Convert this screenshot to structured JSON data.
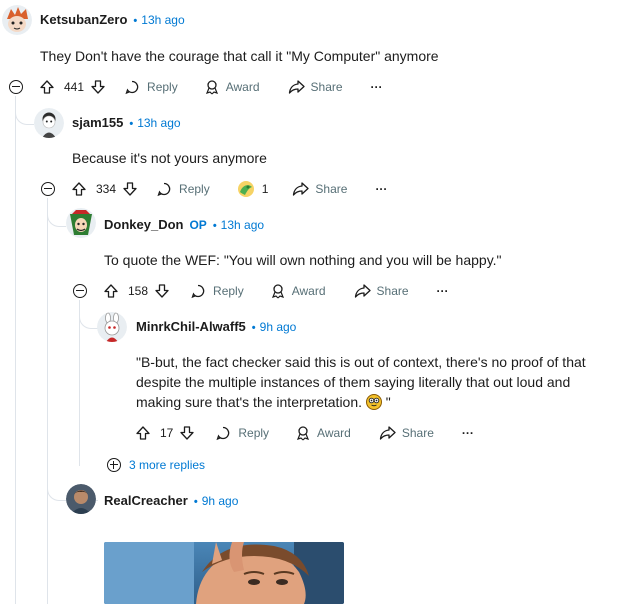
{
  "comments": [
    {
      "author": "KetsubanZero",
      "time": "13h ago",
      "body": "They Don't have the courage that call it \"My Computer\" anymore",
      "score": "441",
      "reply": "Reply",
      "award": "Award",
      "share": "Share",
      "more": "···"
    },
    {
      "author": "sjam155",
      "time": "13h ago",
      "body": "Because it's not yours anymore",
      "score": "334",
      "reply": "Reply",
      "award_count": "1",
      "share": "Share",
      "more": "···"
    },
    {
      "author": "Donkey_Don",
      "op": "OP",
      "time": "13h ago",
      "body": "To quote the WEF: \"You will own nothing and you will be happy.\"",
      "score": "158",
      "reply": "Reply",
      "award": "Award",
      "share": "Share",
      "more": "···"
    },
    {
      "author": "MinrkChil-Alwaff5",
      "time": "9h ago",
      "body": "\"B-but, the fact checker said this is out of context, there's no proof of that despite the multiple instances of them saying literally that out loud and making sure that's the interpretation.",
      "body_end": " \"",
      "score": "17",
      "reply": "Reply",
      "award": "Award",
      "share": "Share",
      "more": "···"
    },
    {
      "author": "RealCreacher",
      "time": "9h ago"
    }
  ],
  "more_replies": "3 more replies",
  "colors": {
    "link": "#0079d3",
    "meta": "#576f76",
    "thread": "#dfe4ea"
  },
  "icons": [
    "upvote-icon",
    "downvote-icon",
    "reply-icon",
    "award-icon",
    "share-icon",
    "collapse-icon",
    "expand-icon"
  ]
}
